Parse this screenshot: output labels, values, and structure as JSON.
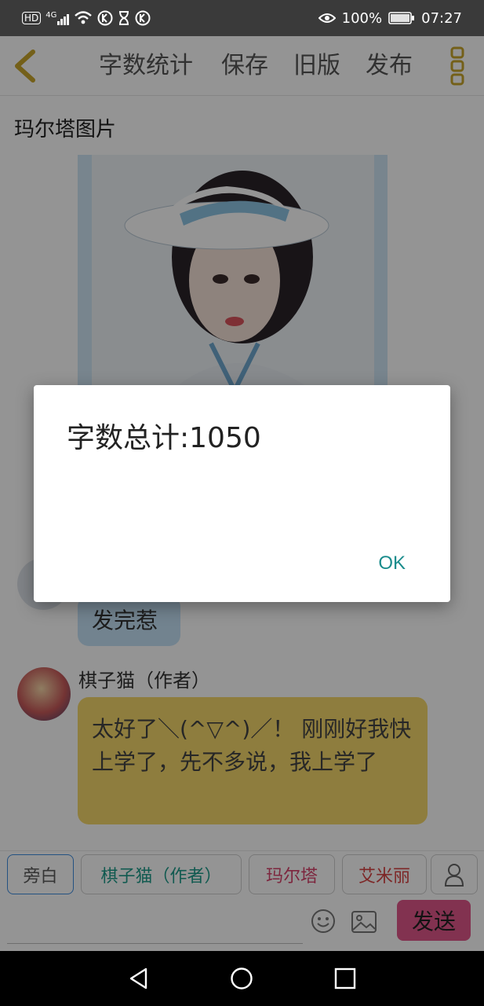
{
  "status_bar": {
    "left_icons": [
      "hd-icon",
      "signal-4g-icon",
      "wifi-icon",
      "k-app-icon",
      "hourglass-icon",
      "k-app-icon"
    ],
    "hd_label": "HD",
    "network_label": "4G",
    "battery_percent": "100%",
    "time": "07:27"
  },
  "toolbar": {
    "word_count": "字数统计",
    "save": "保存",
    "old_version": "旧版",
    "publish": "发布"
  },
  "story": {
    "section_title": "玛尔塔图片"
  },
  "messages": [
    {
      "text": "发完惹"
    },
    {
      "name": "棋子猫（作者）",
      "text": "太好了＼(^▽^)／！ 刚刚好我快上学了，先不多说，我上学了"
    }
  ],
  "roles": [
    {
      "label": "旁白",
      "color": "#5a5a5a"
    },
    {
      "label": "棋子猫（作者）",
      "color": "#1e9b8a"
    },
    {
      "label": "玛尔塔",
      "color": "#d8436b"
    },
    {
      "label": "艾米丽",
      "color": "#d84343"
    }
  ],
  "composer": {
    "send": "发送"
  },
  "dialog": {
    "message": "字数总计:1050",
    "ok": "OK"
  },
  "colors": {
    "accent_gold": "#d1b23a",
    "author_bubble": "#f5d76b",
    "reply_bubble": "#c4e2f6",
    "send_button": "#e0578a",
    "dialog_button": "#1a8c8c"
  }
}
